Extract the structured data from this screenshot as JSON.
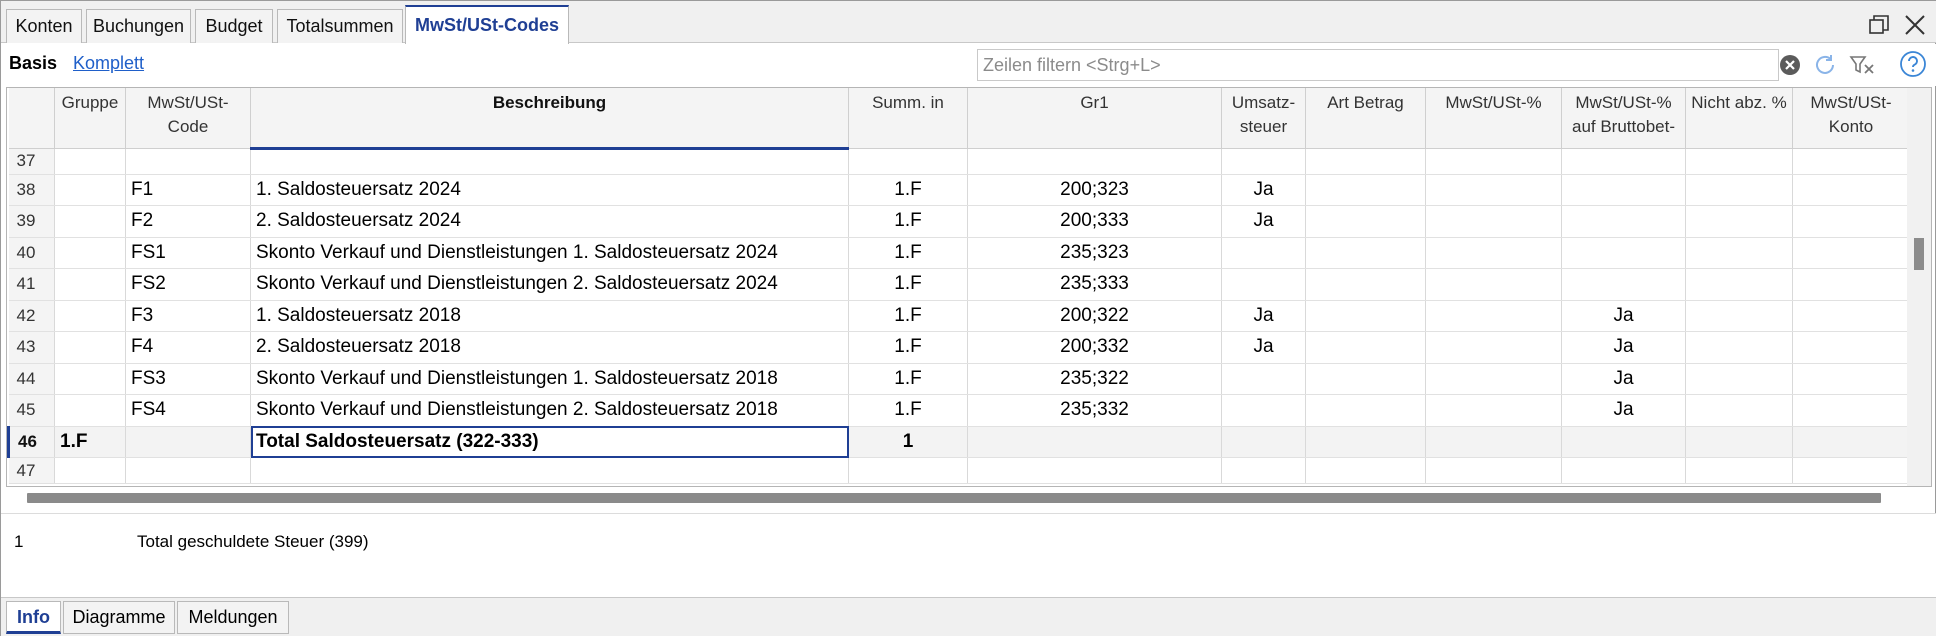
{
  "tabs": [
    "Konten",
    "Buchungen",
    "Budget",
    "Totalsummen",
    "MwSt/USt-Codes"
  ],
  "active_tab": "MwSt/USt-Codes",
  "views": {
    "basis": "Basis",
    "komplett": "Komplett"
  },
  "filter": {
    "placeholder": "Zeilen filtern <Strg+L>",
    "value": ""
  },
  "columns": {
    "gruppe": "Gruppe",
    "code_1": "MwSt/USt-",
    "code_2": "Code",
    "beschreibung": "Beschreibung",
    "summ_in": "Summ. in",
    "gr1": "Gr1",
    "umsatz_1": "Umsatz-",
    "umsatz_2": "steuer",
    "art_betrag": "Art Betrag",
    "mwst_pct": "MwSt/USt-%",
    "brutto_1": "MwSt/USt-%",
    "brutto_2": "auf Bruttobet-",
    "nicht_abz": "Nicht abz. %",
    "konto_1": "MwSt/USt-",
    "konto_2": "Konto"
  },
  "rows": [
    {
      "num": "37",
      "gruppe": "",
      "code": "",
      "beschreibung": "",
      "summ_in": "",
      "gr1": "",
      "umsatz": "",
      "brutto": ""
    },
    {
      "num": "38",
      "gruppe": "",
      "code": "F1",
      "beschreibung": "1. Saldosteuersatz 2024",
      "summ_in": "1.F",
      "gr1": "200;323",
      "umsatz": "Ja",
      "brutto": ""
    },
    {
      "num": "39",
      "gruppe": "",
      "code": "F2",
      "beschreibung": "2. Saldosteuersatz 2024",
      "summ_in": "1.F",
      "gr1": "200;333",
      "umsatz": "Ja",
      "brutto": ""
    },
    {
      "num": "40",
      "gruppe": "",
      "code": "FS1",
      "beschreibung": "Skonto Verkauf und Dienstleistungen 1. Saldosteuersatz 2024",
      "summ_in": "1.F",
      "gr1": "235;323",
      "umsatz": "",
      "brutto": ""
    },
    {
      "num": "41",
      "gruppe": "",
      "code": "FS2",
      "beschreibung": "Skonto Verkauf und Dienstleistungen 2. Saldosteuersatz 2024",
      "summ_in": "1.F",
      "gr1": "235;333",
      "umsatz": "",
      "brutto": ""
    },
    {
      "num": "42",
      "gruppe": "",
      "code": "F3",
      "beschreibung": "1. Saldosteuersatz 2018",
      "summ_in": "1.F",
      "gr1": "200;322",
      "umsatz": "Ja",
      "brutto": "Ja"
    },
    {
      "num": "43",
      "gruppe": "",
      "code": "F4",
      "beschreibung": "2. Saldosteuersatz 2018",
      "summ_in": "1.F",
      "gr1": "200;332",
      "umsatz": "Ja",
      "brutto": "Ja"
    },
    {
      "num": "44",
      "gruppe": "",
      "code": "FS3",
      "beschreibung": "Skonto Verkauf und Dienstleistungen 1. Saldosteuersatz 2018",
      "summ_in": "1.F",
      "gr1": "235;322",
      "umsatz": "",
      "brutto": "Ja"
    },
    {
      "num": "45",
      "gruppe": "",
      "code": "FS4",
      "beschreibung": "Skonto Verkauf und Dienstleistungen 2. Saldosteuersatz 2018",
      "summ_in": "1.F",
      "gr1": "235;332",
      "umsatz": "",
      "brutto": "Ja"
    },
    {
      "num": "46",
      "gruppe": "1.F",
      "code": "",
      "beschreibung": "Total Saldosteuersatz (322-333)",
      "summ_in": "1",
      "gr1": "",
      "umsatz": "",
      "brutto": ""
    },
    {
      "num": "47",
      "gruppe": "",
      "code": "",
      "beschreibung": "",
      "summ_in": "",
      "gr1": "",
      "umsatz": "",
      "brutto": ""
    }
  ],
  "info": {
    "num": "1",
    "text": "Total geschuldete Steuer (399)"
  },
  "bottom_tabs": [
    "Info",
    "Diagramme",
    "Meldungen"
  ],
  "icons": {
    "restore": "restore-window-icon",
    "close": "close-icon",
    "clear": "clear-filter-icon",
    "refresh": "refresh-icon",
    "filter_toggle": "filter-toggle-icon",
    "help": "help-icon"
  },
  "colors": {
    "accent": "#1f3f94",
    "link": "#1f5fc9"
  }
}
